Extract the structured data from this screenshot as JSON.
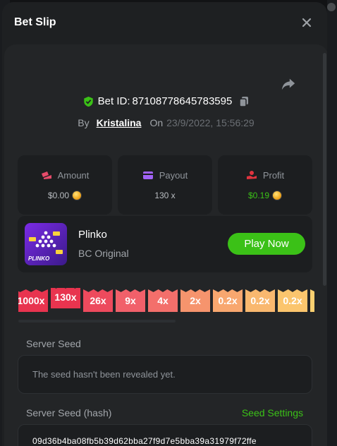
{
  "modal": {
    "title": "Bet Slip"
  },
  "bet": {
    "id_label": "Bet ID:",
    "id": "87108778645783595",
    "by_label": "By",
    "user": "Kristalina",
    "on_label": "On",
    "date": "23/9/2022, 15:56:29"
  },
  "stats": [
    {
      "label": "Amount",
      "value": "$0.00",
      "icon": "amount-icon",
      "color": "#e64b6a"
    },
    {
      "label": "Payout",
      "value": "130 x",
      "icon": "payout-icon",
      "color": "#a062f5"
    },
    {
      "label": "Profit",
      "value": "$0.19",
      "icon": "profit-icon",
      "color": "#e0343f"
    }
  ],
  "game": {
    "name": "Plinko",
    "subtitle": "BC Original",
    "play_label": "Play Now",
    "thumb_text": "PLINKO"
  },
  "multipliers": [
    "1000x",
    "130x",
    "26x",
    "9x",
    "4x",
    "2x",
    "0.2x",
    "0.2x",
    "0.2x"
  ],
  "multiplier_colors": [
    "#e8344f",
    "#e8344f",
    "#ed4a5d",
    "#f1606a",
    "#f36f6b",
    "#f6946d",
    "#f8a76f",
    "#f9b86f",
    "#fbc56d"
  ],
  "server_seed": {
    "label": "Server Seed",
    "placeholder": "The seed hasn't been revealed yet."
  },
  "server_seed_hash": {
    "label": "Server Seed (hash)",
    "settings_label": "Seed Settings",
    "value": "09d36b4ba08fb5b39d62bba27f9d7e5bba39a31979f72ffe"
  }
}
